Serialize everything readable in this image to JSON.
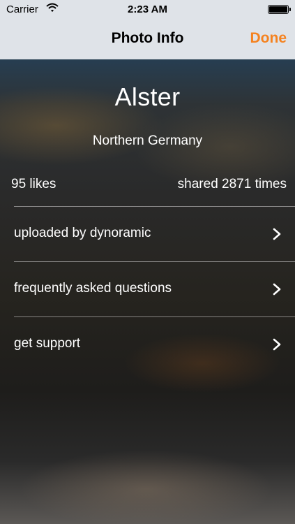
{
  "status_bar": {
    "carrier": "Carrier",
    "time": "2:23 AM"
  },
  "nav_bar": {
    "title": "Photo Info",
    "done_label": "Done",
    "accent_color": "#f5821f"
  },
  "photo": {
    "title": "Alster",
    "location": "Northern Germany",
    "likes": "95 likes",
    "shares": "shared 2871 times"
  },
  "menu": {
    "items": [
      {
        "label": "uploaded by dynoramic",
        "icon": "chevron-right-icon"
      },
      {
        "label": "frequently asked questions",
        "icon": "chevron-right-icon"
      },
      {
        "label": "get support",
        "icon": "chevron-right-icon"
      }
    ]
  }
}
